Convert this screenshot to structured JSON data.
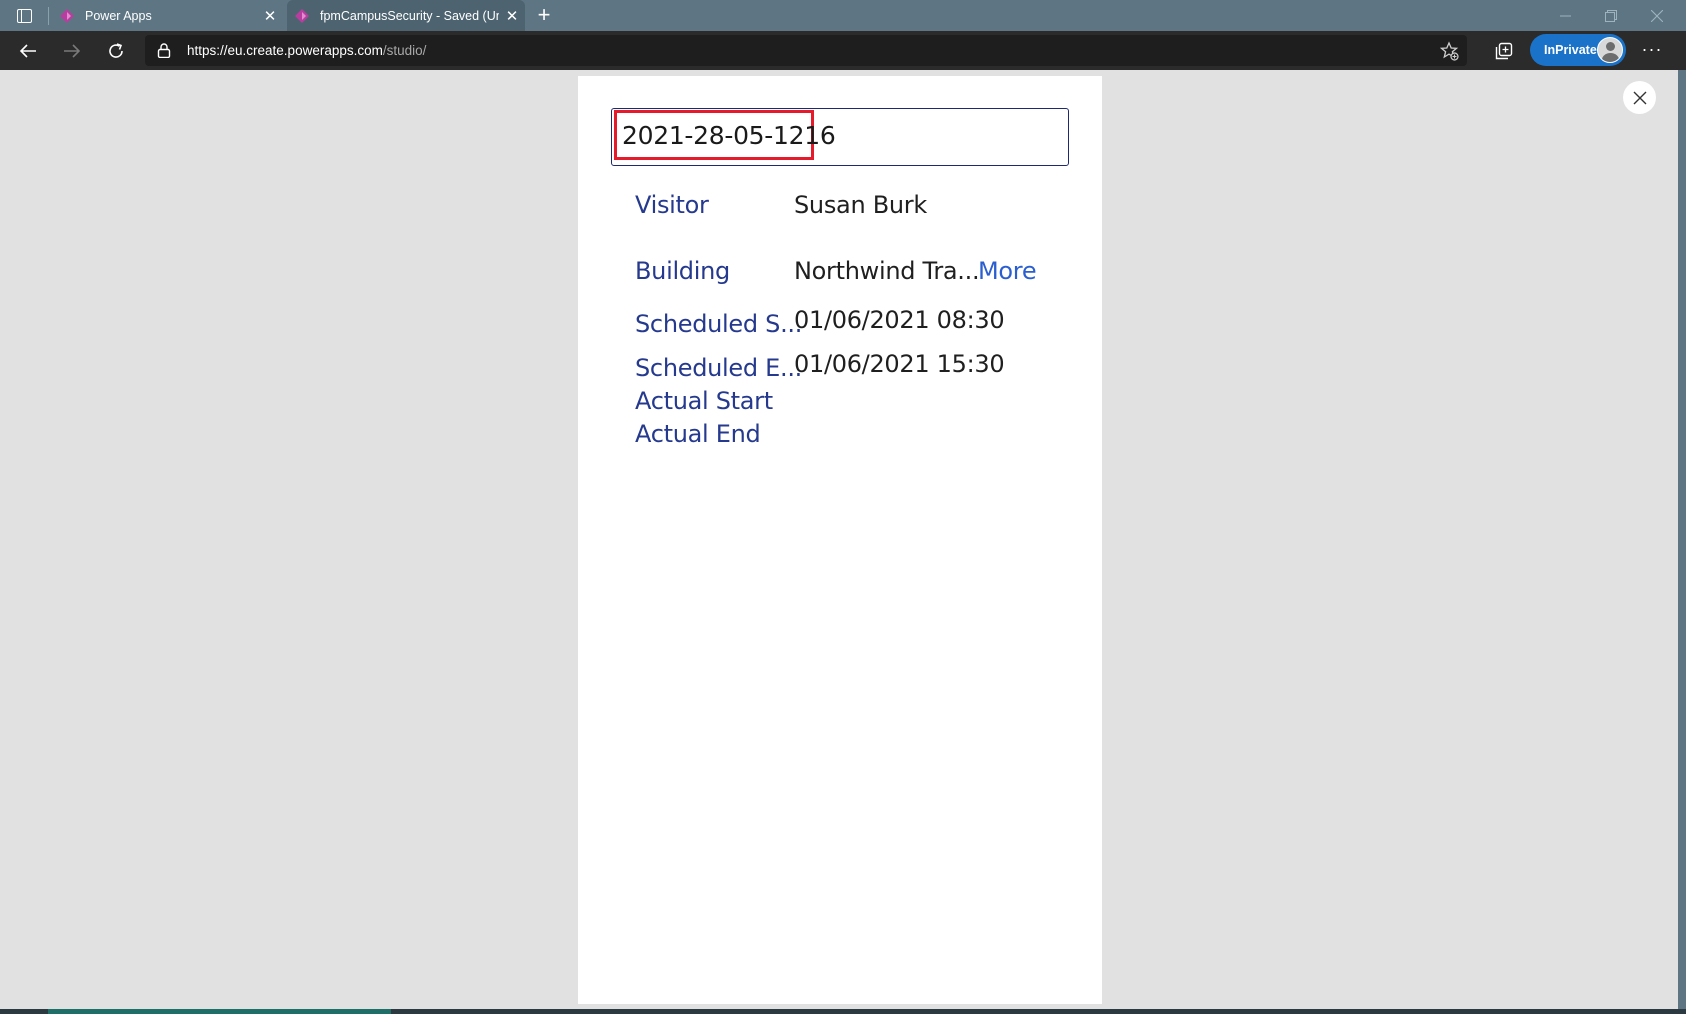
{
  "browser": {
    "tabs": [
      {
        "title": "Power Apps",
        "active": false
      },
      {
        "title": "fpmCampusSecurity - Saved (Un",
        "active": true
      }
    ],
    "url_host": "https://eu.create.powerapps.com",
    "url_path": "/studio/",
    "inprivate_label": "InPrivate",
    "colors": {
      "tabbar": "#5e7684",
      "navbar": "#2b2b2b",
      "inprivate": "#1a73c9"
    }
  },
  "app": {
    "record_id": "2021-28-05-1216",
    "fields": {
      "visitor_label": "Visitor",
      "visitor_value": "Susan Burk",
      "building_label": "Building",
      "building_value": "Northwind Tra...",
      "more_link": "More",
      "sched_start_label": "Scheduled S...",
      "sched_start_value": "01/06/2021 08:30",
      "sched_end_label": "Scheduled E...",
      "sched_end_value": "01/06/2021 15:30",
      "actual_start_label": "Actual Start",
      "actual_end_label": "Actual End"
    },
    "colors": {
      "label": "#253a8e",
      "link": "#2b5fd0",
      "highlight": "#e51a2b"
    }
  }
}
